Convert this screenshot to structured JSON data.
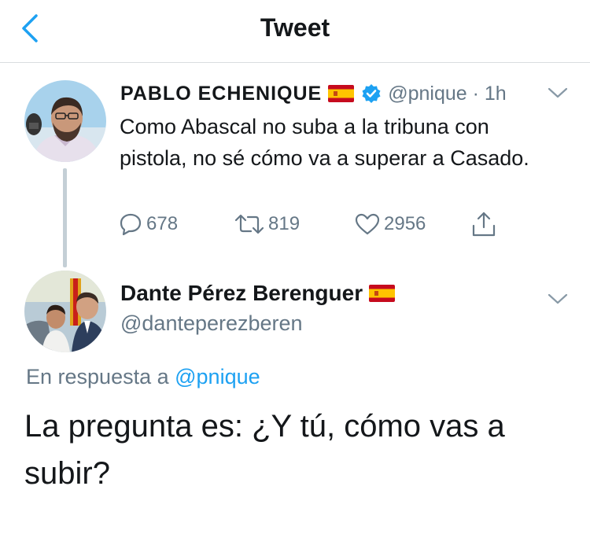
{
  "header": {
    "title": "Tweet"
  },
  "tweet1": {
    "author_name": "PABLO ECHENIQUE",
    "handle": "@pnique",
    "separator": " · ",
    "time": "1h",
    "text": "Como Abascal no suba a la tribuna con pistola, no sé cómo va a superar a Casado.",
    "replies": "678",
    "retweets": "819",
    "likes": "2956",
    "verified": true
  },
  "tweet2": {
    "author_name": "Dante Pérez Berenguer",
    "handle": "@danteperezberen",
    "reply_prefix": "En respuesta a ",
    "reply_mention": "@pnique",
    "text": "La pregunta es: ¿Y tú, cómo vas a subir?"
  },
  "icons": {
    "back": "chevron-left-icon",
    "more": "chevron-down-icon",
    "reply": "speech-bubble-icon",
    "retweet": "retweet-icon",
    "like": "heart-icon",
    "share": "share-icon",
    "verified": "verified-badge-icon",
    "flag": "spain-flag-icon"
  },
  "colors": {
    "accent": "#1da1f2",
    "text_primary": "#14171a",
    "text_secondary": "#657786",
    "divider": "#d9dde0"
  }
}
